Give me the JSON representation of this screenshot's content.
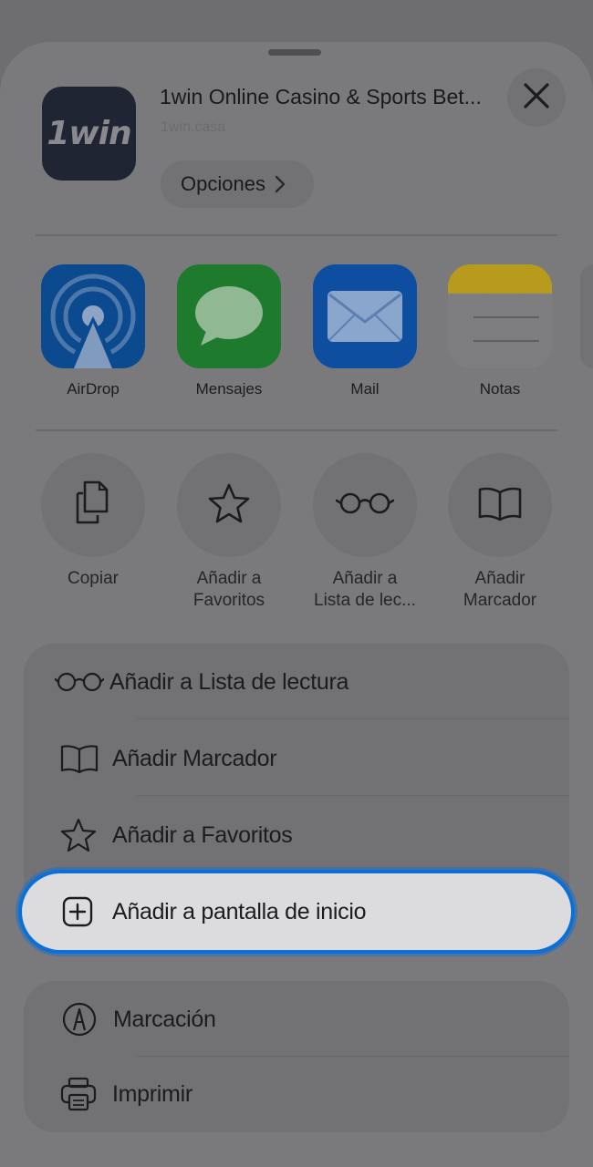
{
  "header": {
    "app_icon_text": "1win",
    "page_title": "1win Online Casino & Sports Bet...",
    "page_url": "1win.casa",
    "options_label": "Opciones"
  },
  "share_apps": [
    {
      "label": "AirDrop",
      "icon": "airdrop-icon"
    },
    {
      "label": "Mensajes",
      "icon": "messages-icon"
    },
    {
      "label": "Mail",
      "icon": "mail-icon"
    },
    {
      "label": "Notas",
      "icon": "notes-icon"
    }
  ],
  "quick_actions": [
    {
      "line1": "Copiar",
      "line2": "",
      "icon": "copy-icon"
    },
    {
      "line1": "Añadir a",
      "line2": "Favoritos",
      "icon": "star-icon"
    },
    {
      "line1": "Añadir a",
      "line2": "Lista de lec...",
      "icon": "glasses-icon"
    },
    {
      "line1": "Añadir",
      "line2": "Marcador",
      "icon": "book-icon"
    }
  ],
  "menu_group_1": [
    {
      "label": "Añadir a Lista de lectura",
      "icon": "glasses-icon"
    },
    {
      "label": "Añadir Marcador",
      "icon": "book-icon"
    },
    {
      "label": "Añadir a Favoritos",
      "icon": "star-icon"
    }
  ],
  "highlighted": {
    "label": "Añadir a pantalla de inicio",
    "icon": "plus-square-icon"
  },
  "menu_group_2": [
    {
      "label": "Marcación",
      "icon": "markup-icon"
    },
    {
      "label": "Imprimir",
      "icon": "printer-icon"
    }
  ],
  "colors": {
    "highlight_ring": "#0a6fd8",
    "airdrop": "#0b4a8f",
    "messages": "#1e7a2c",
    "mail": "#0d4ea0",
    "notes_top": "#b89a1c"
  }
}
